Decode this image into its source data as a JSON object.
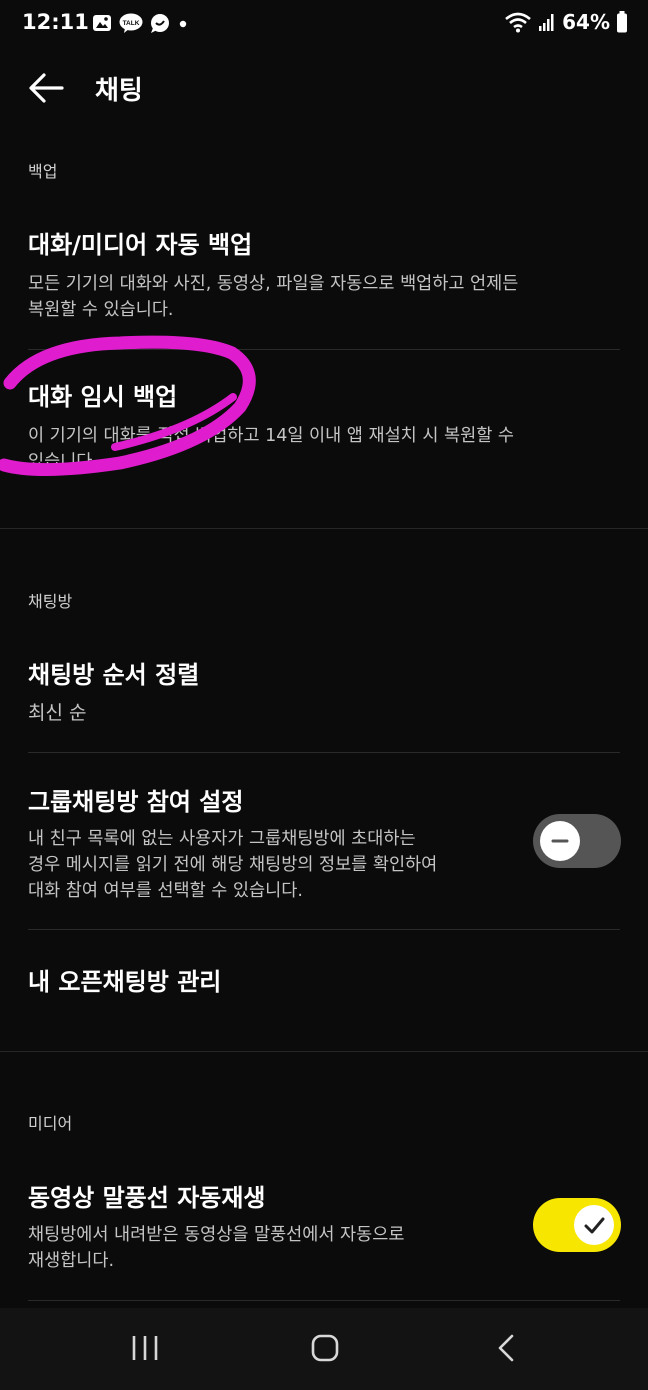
{
  "status_bar": {
    "time": "12:11",
    "battery": "64%",
    "left_icons": [
      "gallery-icon",
      "talk-icon",
      "chat-bubble-icon",
      "dot-icon"
    ],
    "right_icons": [
      "wifi-icon",
      "signal-icon",
      "battery-icon"
    ]
  },
  "header": {
    "title": "채팅",
    "back_icon": "arrow-left-icon"
  },
  "sections": {
    "backup": {
      "header": "백업",
      "auto_backup": {
        "title": "대화/미디어 자동 백업",
        "desc_line1": "모든 기기의 대화와 사진, 동영상, 파일을 자동으로 백업하고 언제든",
        "desc_line2": "복원할 수 있습니다."
      },
      "temp_backup": {
        "title": "대화 임시 백업",
        "desc_line1": "이 기기의 대화를 직접 백업하고 14일 이내 앱 재설치 시 복원할 수",
        "desc_line2": "있습니다."
      }
    },
    "chatroom": {
      "header": "채팅방",
      "sort": {
        "title": "채팅방 순서 정렬",
        "value": "최신 순"
      },
      "group_join": {
        "title": "그룹채팅방 참여 설정",
        "desc_line1": "내 친구 목록에 없는 사용자가 그룹채팅방에 초대하는",
        "desc_line2": "경우 메시지를 읽기 전에 해당 채팅방의 정보를 확인하여",
        "desc_line3": "대화 참여 여부를 선택할 수 있습니다.",
        "toggle_on": false
      },
      "open_chat": {
        "title": "내 오픈채팅방 관리"
      }
    },
    "media": {
      "header": "미디어",
      "autoplay": {
        "title": "동영상 말풍선 자동재생",
        "desc_line1": "채팅방에서 내려받은 동영상을 말풍선에서 자동으로",
        "desc_line2": "재생합니다.",
        "toggle_on": true
      }
    }
  },
  "nav_bar": {
    "icons": [
      "recent-apps-icon",
      "home-icon",
      "back-nav-icon"
    ]
  },
  "colors": {
    "background": "#0b0b0b",
    "toggle_on": "#f7e600",
    "toggle_off": "#555555",
    "annotation": "#e01ccf"
  }
}
